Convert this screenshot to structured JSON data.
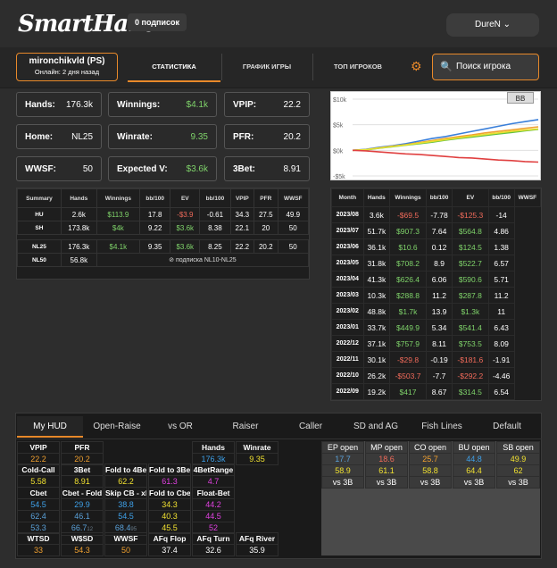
{
  "header": {
    "logo": "SmartHand",
    "subscription": "0 подписок",
    "user": "DureN ⌄"
  },
  "player": {
    "name": "mironchikvld (PS)",
    "status": "Онлайн: 2 дня назад"
  },
  "nav": {
    "tabs": [
      "СТАТИСТИКА",
      "ГРАФИК ИГРЫ",
      "ТОП ИГРОКОВ"
    ],
    "search_placeholder": "Поиск игрока"
  },
  "stats": {
    "hands_label": "Hands:",
    "hands": "176.3k",
    "winnings_label": "Winnings:",
    "winnings": "$4.1k",
    "vpip_label": "VPIP:",
    "vpip": "22.2",
    "home_label": "Home:",
    "home": "NL25",
    "winrate_label": "Winrate:",
    "winrate": "9.35",
    "pfr_label": "PFR:",
    "pfr": "20.2",
    "wwsf_label": "WWSF:",
    "wwsf": "50",
    "expected_label": "Expected V:",
    "expected": "$3.6k",
    "threebet_label": "3Bet:",
    "threebet": "8.91"
  },
  "summary": {
    "headers": [
      "Summary",
      "Hands",
      "Winnings",
      "bb/100",
      "EV",
      "bb/100",
      "VPIP",
      "PFR",
      "WWSF"
    ],
    "rows": [
      [
        "HU",
        "2.6k",
        "$113.9",
        "17.8",
        "-$3.9",
        "-0.61",
        "34.3",
        "27.5",
        "49.9"
      ],
      [
        "SH",
        "173.8k",
        "$4k",
        "9.22",
        "$3.6k",
        "8.38",
        "22.1",
        "20",
        "50"
      ],
      [
        "NL25",
        "176.3k",
        "$4.1k",
        "9.35",
        "$3.6k",
        "8.25",
        "22.2",
        "20.2",
        "50"
      ]
    ],
    "nl50": {
      "label": "NL50",
      "hands": "56.8k",
      "note": "подписка NL10-NL25"
    }
  },
  "chart_data": {
    "type": "line",
    "title": "",
    "xlabel": "",
    "ylabel": "",
    "yticks": [
      "$10k",
      "$5k",
      "$0k",
      "-$5k"
    ],
    "ylim": [
      -5000,
      10000
    ],
    "legend": "BB",
    "series": [
      {
        "color": "#3a7fd9",
        "values": [
          0,
          200,
          600,
          900,
          1300,
          1800,
          2300,
          2700,
          3200,
          3700,
          4200,
          4700,
          5200,
          5600,
          6000
        ]
      },
      {
        "color": "#f0a030",
        "values": [
          0,
          150,
          500,
          800,
          1100,
          1500,
          1900,
          2300,
          2700,
          3000,
          3400,
          3700,
          4000,
          4300,
          4600
        ]
      },
      {
        "color": "#60c040",
        "values": [
          0,
          100,
          400,
          700,
          1000,
          1300,
          1600,
          2000,
          2300,
          2600,
          2900,
          3200,
          3500,
          3800,
          4100
        ]
      },
      {
        "color": "#e8e030",
        "values": [
          0,
          120,
          450,
          750,
          1050,
          1400,
          1750,
          2100,
          2450,
          2800,
          3100,
          3400,
          3700,
          3950,
          4200
        ]
      },
      {
        "color": "#e04040",
        "values": [
          0,
          -100,
          -300,
          -500,
          -700,
          -800,
          -1000,
          -1200,
          -1400,
          -1500,
          -1700,
          -1900,
          -2000,
          -2200,
          -2300
        ]
      }
    ]
  },
  "monthly": {
    "headers": [
      "Month",
      "Hands",
      "Winnings",
      "bb/100",
      "EV",
      "bb/100",
      "WWSF"
    ],
    "rows": [
      [
        "2023/08",
        "3.6k",
        "-$69.5",
        "-7.78",
        "-$125.3",
        "-14"
      ],
      [
        "2023/07",
        "51.7k",
        "$907.3",
        "7.64",
        "$564.8",
        "4.86"
      ],
      [
        "2023/06",
        "36.1k",
        "$10.6",
        "0.12",
        "$124.5",
        "1.38"
      ],
      [
        "2023/05",
        "31.8k",
        "$708.2",
        "8.9",
        "$522.7",
        "6.57"
      ],
      [
        "2023/04",
        "41.3k",
        "$626.4",
        "6.06",
        "$590.6",
        "5.71"
      ],
      [
        "2023/03",
        "10.3k",
        "$288.8",
        "11.2",
        "$287.8",
        "11.2"
      ],
      [
        "2023/02",
        "48.8k",
        "$1.7k",
        "13.9",
        "$1.3k",
        "11"
      ],
      [
        "2023/01",
        "33.7k",
        "$449.9",
        "5.34",
        "$541.4",
        "6.43"
      ],
      [
        "2022/12",
        "37.1k",
        "$757.9",
        "8.11",
        "$753.5",
        "8.09"
      ],
      [
        "2022/11",
        "30.1k",
        "-$29.8",
        "-0.19",
        "-$181.6",
        "-1.91"
      ],
      [
        "2022/10",
        "26.2k",
        "-$503.7",
        "-7.7",
        "-$292.2",
        "-4.46"
      ],
      [
        "2022/09",
        "19.2k",
        "$417",
        "8.67",
        "$314.5",
        "6.54"
      ]
    ]
  },
  "hud": {
    "tabs": [
      "My HUD",
      "Open-Raise",
      "vs OR",
      "Raiser",
      "Caller",
      "SD and AG",
      "Fish Lines",
      "Default"
    ],
    "labels": {
      "vpip": "VPIP",
      "pfr": "PFR",
      "hands": "Hands",
      "winrate": "Winrate",
      "coldcall": "Cold-Call",
      "threebet": "3Bet",
      "fold4bet": "Fold to 4Bet",
      "fold3bet": "Fold to 3Bet",
      "fourbetrange": "4BetRange",
      "cbet": "Cbet",
      "cbetfold": "Cbet - Fold",
      "skipcb": "Skip CB - xF",
      "foldcbet": "Fold to Cbet",
      "floatbet": "Float-Bet",
      "wtsd": "WTSD",
      "wssd": "W$SD",
      "wwsf": "WWSF",
      "afqflop": "AFq Flop",
      "afqturn": "AFq Turn",
      "afqriver": "AFq River",
      "ep": "EP open",
      "mp": "MP open",
      "co": "CO open",
      "bu": "BU open",
      "sb": "SB open",
      "vs3b": "vs 3B"
    },
    "values": {
      "vpip": "22.2",
      "pfr": "20.2",
      "hands": "176.3k",
      "winrate": "9.35",
      "coldcall": "5.58",
      "threebet": "8.91",
      "fold4bet": "62.2",
      "fold3bet": "61.3",
      "fourbetrange": "4.7",
      "cbet1": "54.5",
      "cbet2": "62.4",
      "cbet3": "53.3",
      "cbetfold1": "29.9",
      "cbetfold2": "46.1",
      "cbetfold3": "66.7",
      "cbetfold3_sup": "12",
      "skipcb1": "38.8",
      "skipcb2": "54.5",
      "skipcb3": "68.4",
      "skipcb3_sup": "95",
      "foldcbet1": "34.3",
      "foldcbet2": "40.3",
      "foldcbet3": "45.5",
      "float1": "44.2",
      "float2": "44.5",
      "float3": "52",
      "wtsd": "33",
      "wssd": "54.3",
      "wwsf": "50",
      "afqflop": "37.4",
      "afqturn": "32.6",
      "afqriver": "35.9",
      "ep1": "17.7",
      "ep2": "58.9",
      "mp1": "18.6",
      "mp2": "61.1",
      "co1": "25.7",
      "co2": "58.8",
      "bu1": "44.8",
      "bu2": "64.4",
      "sb1": "49.9",
      "sb2": "62"
    }
  }
}
